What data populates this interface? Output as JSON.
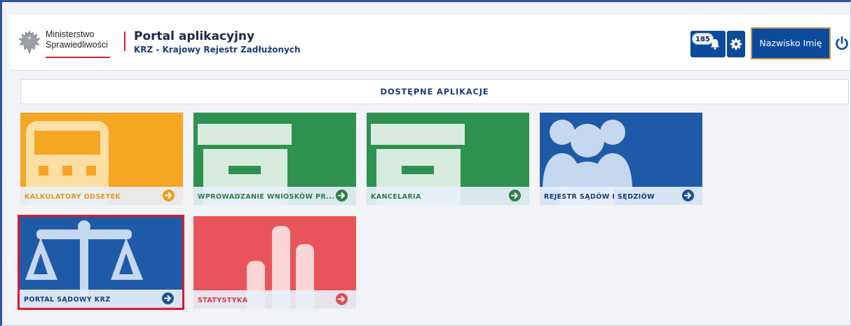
{
  "header": {
    "ministry_line1": "Ministerstwo",
    "ministry_line2": "Sprawiedliwości",
    "app_title": "Portal aplikacyjny",
    "app_subtitle": "KRZ - Krajowy Rejestr Zadłużonych",
    "notification_count": "185",
    "user_name": "Nazwisko Imię"
  },
  "section": {
    "title": "DOSTĘPNE APLIKACJE"
  },
  "tiles": [
    {
      "label": "KALKULATORY ODSETEK",
      "color": "#f5a623",
      "label_color": "#e8961a",
      "icon": "calculator-icon",
      "arrow_color": "#f09b1c"
    },
    {
      "label": "WPROWADZANIE WNIOSKÓW PR...",
      "color": "#2e9150",
      "label_color": "#2e7d4a",
      "icon": "archive-box-icon",
      "arrow_color": "#2e7d4a"
    },
    {
      "label": "KANCELARIA",
      "color": "#2e9150",
      "label_color": "#2e7d4a",
      "icon": "archive-box-icon",
      "arrow_color": "#2e7d4a"
    },
    {
      "label": "REJESTR SĄDÓW I SĘDZIÓW",
      "color": "#1f5aa8",
      "label_color": "#1b3d7a",
      "icon": "people-group-icon",
      "arrow_color": "#1f4f9a"
    },
    {
      "label": "PORTAL SĄDOWY KRZ",
      "color": "#1f5aa8",
      "label_color": "#1b3d7a",
      "icon": "scales-icon",
      "arrow_color": "#1f4f9a",
      "selected": true
    },
    {
      "label": "STATYSTYKA",
      "color": "#e8545a",
      "label_color": "#d63a45",
      "icon": "bar-chart-icon",
      "arrow_color": "#e04a52"
    }
  ],
  "colors": {
    "brand_blue": "#0c4a9c",
    "accent_red": "#d4213d"
  }
}
